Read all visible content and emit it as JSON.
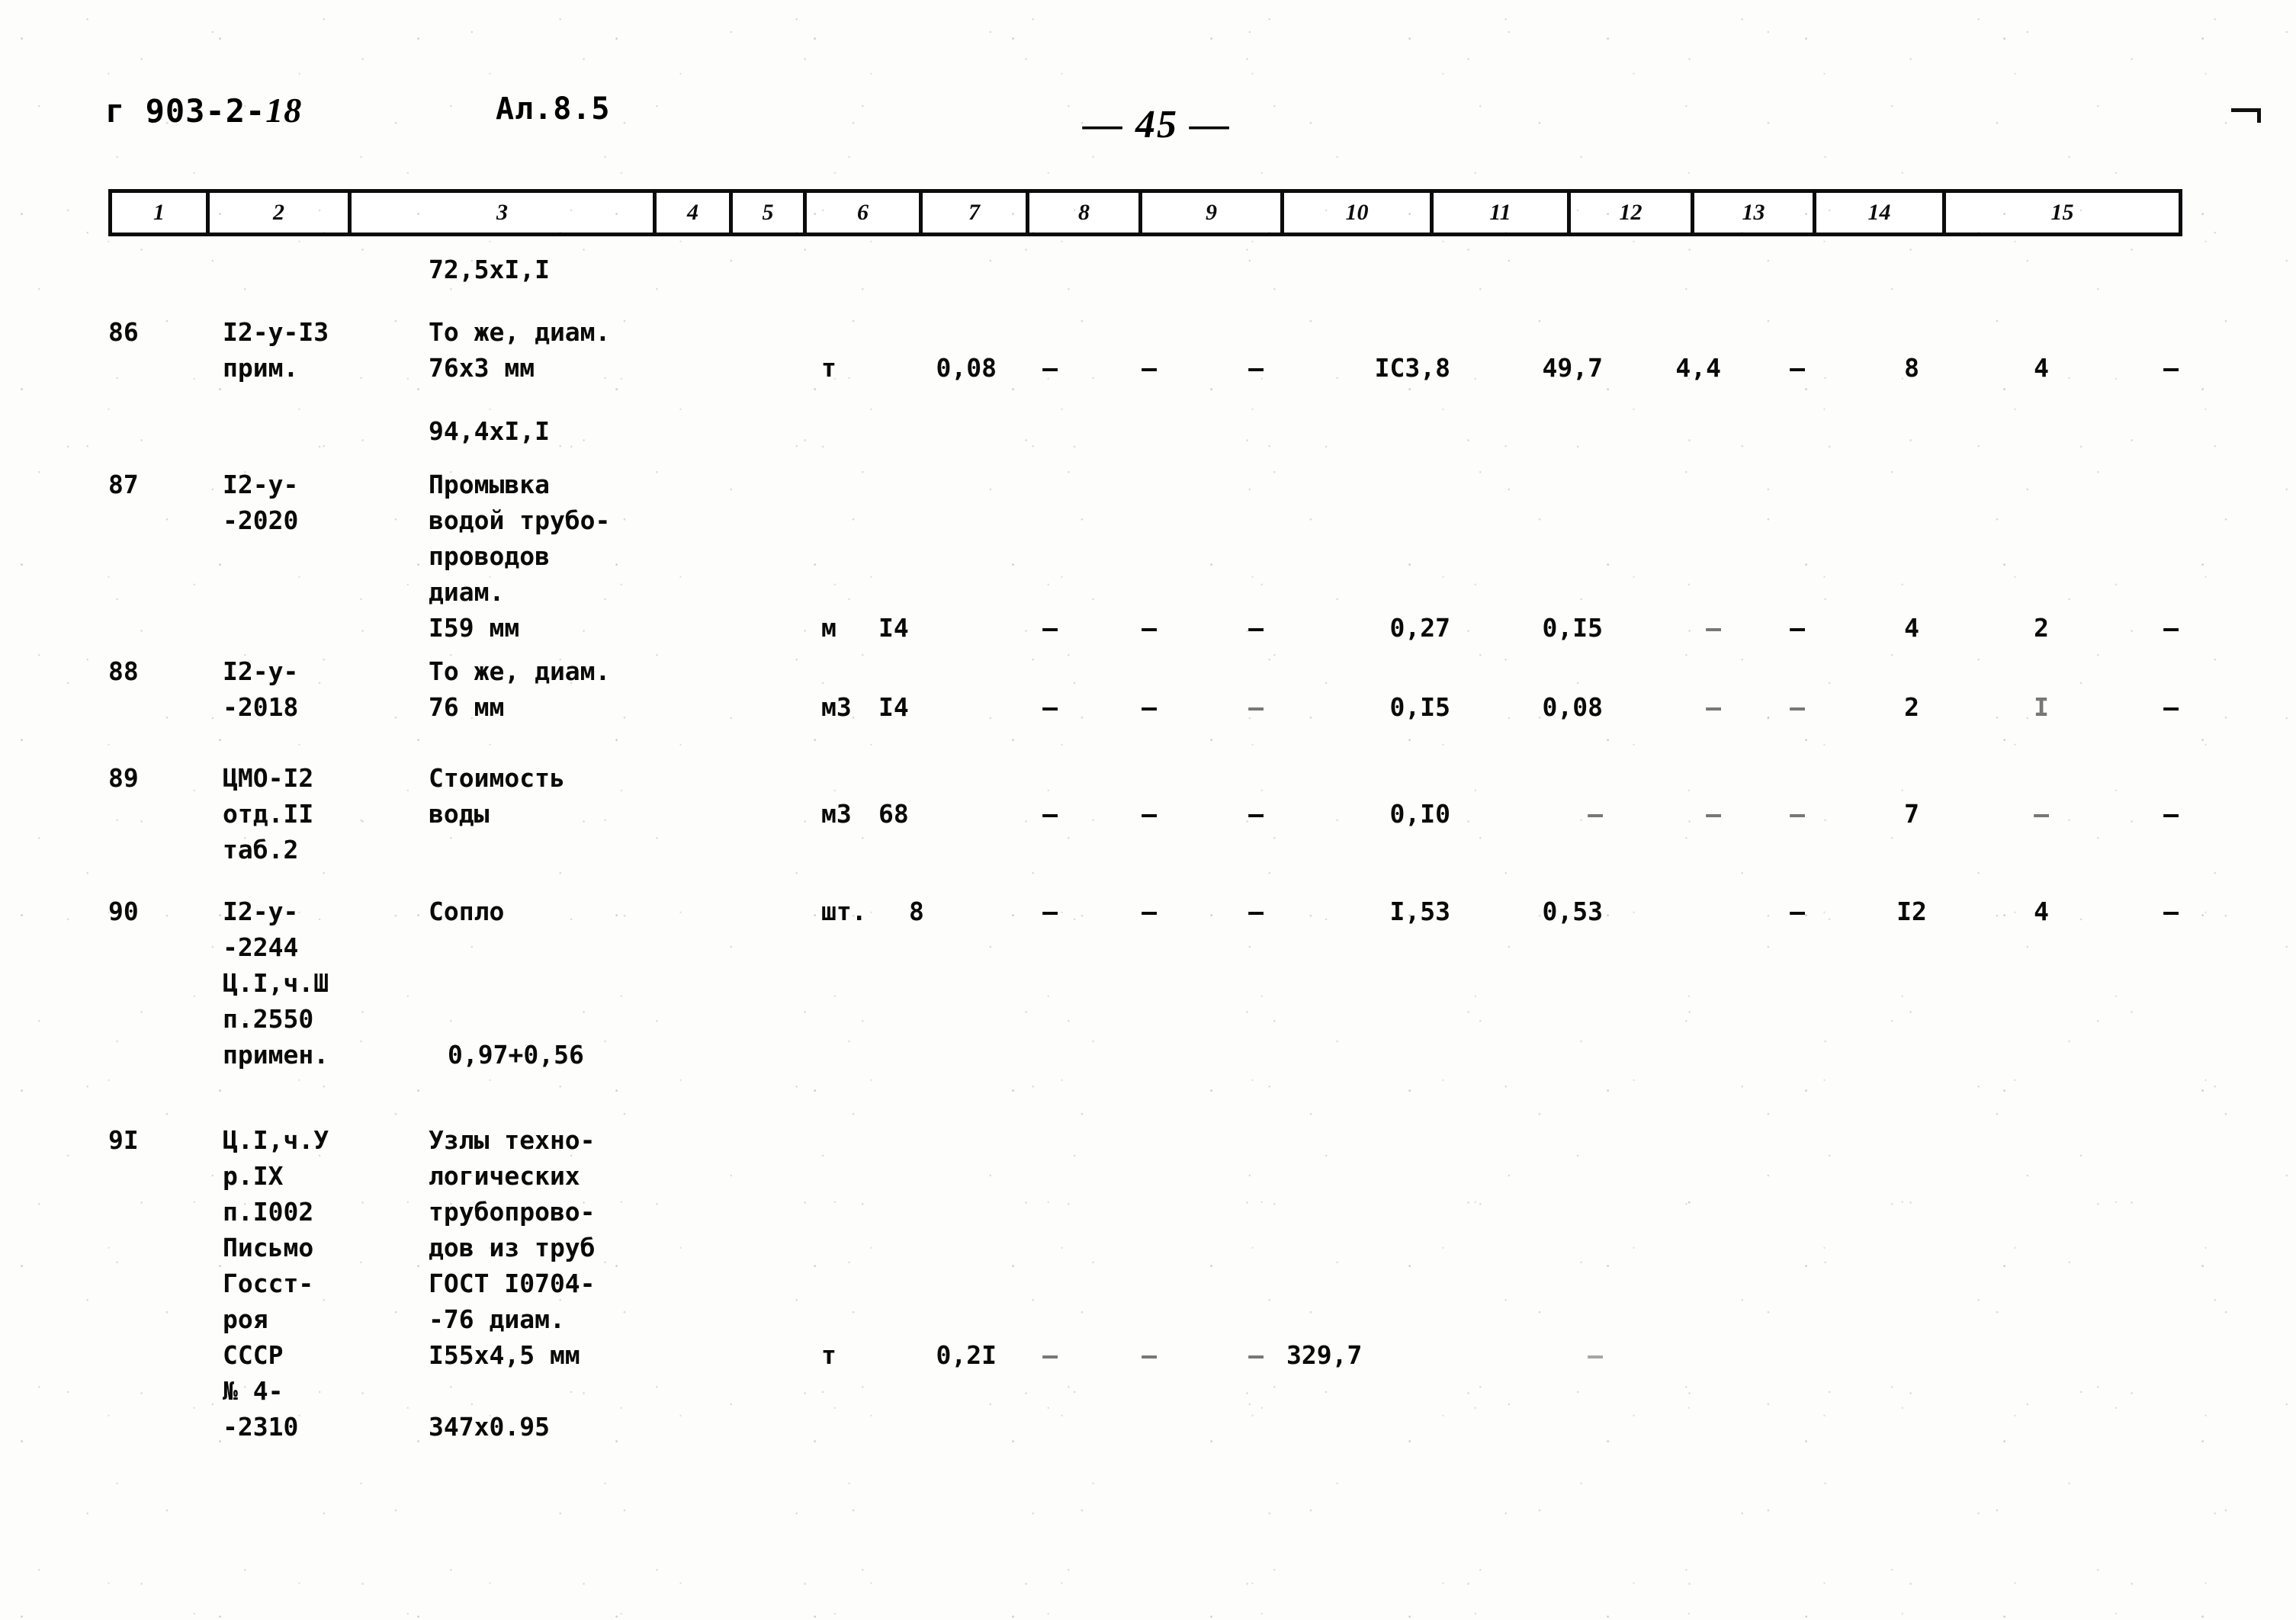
{
  "header": {
    "doc_code_prefix": "г 903-2-",
    "doc_code_hand": "18",
    "album": "Ал.8.5",
    "page_number": "— 45 —"
  },
  "column_numbers": [
    "1",
    "2",
    "3",
    "4",
    "5",
    "6",
    "7",
    "8",
    "9",
    "10",
    "11",
    "12",
    "13",
    "14",
    "15"
  ],
  "standalone_notes": {
    "above_row86": "72,5хI,I",
    "below_row86": "94,4хI,I",
    "row90_note": "0,97+0,56",
    "row91_note": "347х0.95"
  },
  "rows": [
    {
      "num": "86",
      "code": "I2-у-I3\nприм.",
      "name": "То же, диам.\n76х3 мм",
      "unit": "т",
      "c5": "0,08",
      "c6": "–",
      "c7": "–",
      "c8": "–",
      "c9": "IC3,8",
      "c10": "49,7",
      "c11": "4,4",
      "c12": "–",
      "c13": "8",
      "c14": "4",
      "c15": "–"
    },
    {
      "num": "87",
      "code": "I2-у-\n-2020",
      "name": "Промывка\nводой трубо-\nпроводов\nдиам.\nI59 мм",
      "unit": "м",
      "c5": "I4",
      "c6": "–",
      "c7": "–",
      "c8": "–",
      "c9": "0,27",
      "c10": "0,I5",
      "c11": "–",
      "c12": "–",
      "c13": "4",
      "c14": "2",
      "c15": "–"
    },
    {
      "num": "88",
      "code": "I2-у-\n-2018",
      "name": "То же, диам.\n76 мм",
      "unit": "м3",
      "c5": "I4",
      "c6": "–",
      "c7": "–",
      "c8": "–",
      "c9": "0,I5",
      "c10": "0,08",
      "c11": "–",
      "c12": "–",
      "c13": "2",
      "c14": "I",
      "c15": "–"
    },
    {
      "num": "89",
      "code": "ЦМО-I2\nотд.II\nтаб.2",
      "name": "Стоимость\nводы",
      "unit": "м3",
      "c5": "68",
      "c6": "–",
      "c7": "–",
      "c8": "–",
      "c9": "0,I0",
      "c10": "–",
      "c11": "–",
      "c12": "–",
      "c13": "7",
      "c14": "–",
      "c15": "–"
    },
    {
      "num": "90",
      "code": "I2-у-\n-2244\nЦ.I,ч.Ш\nп.2550\nпримен.",
      "name": "Сопло",
      "unit": "шт.",
      "c5": "8",
      "c6": "–",
      "c7": "–",
      "c8": "–",
      "c9": "I,53",
      "c10": "0,53",
      "c11": "",
      "c12": "–",
      "c13": "I2",
      "c14": "4",
      "c15": "–"
    },
    {
      "num": "9I",
      "code": "Ц.I,ч.У\nр.IX\nп.I002\nПисьмо\nГосст-\nроя\nСССР\n№ 4-\n-2310",
      "name": "Узлы техно-\nлогических\nтрубопрово-\nдов из труб\nГОСТ I0704-\n-76 диам.\nI55х4,5 мм",
      "unit": "т",
      "c5": "0,2I",
      "c6": "–",
      "c7": "–",
      "c8": "–",
      "c9": "329,7",
      "c10": "–",
      "c11": "",
      "c12": "",
      "c13": "",
      "c14": "",
      "c15": ""
    }
  ]
}
